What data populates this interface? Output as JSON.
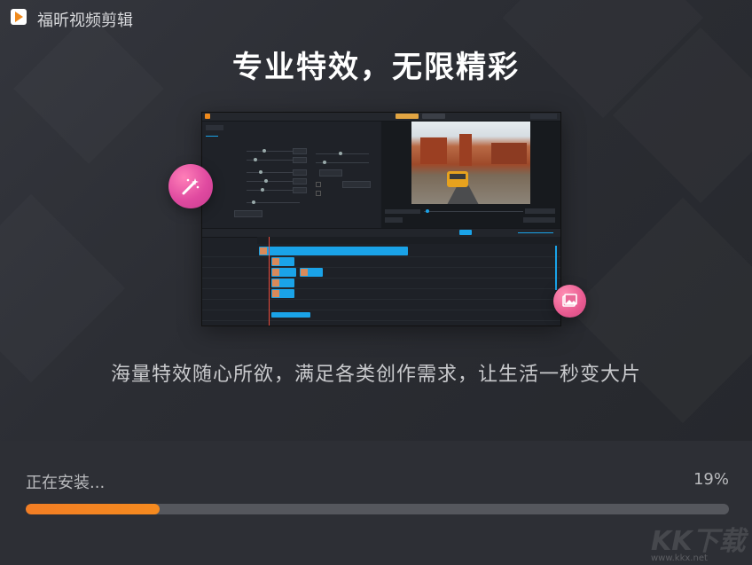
{
  "window": {
    "title": "福昕视频剪辑",
    "logo_icon": "play-logo-icon"
  },
  "hero": {
    "headline": "专业特效，无限精彩",
    "subline": "海量特效随心所欲，满足各类创作需求，让生活一秒变大片"
  },
  "install": {
    "status": "正在安装...",
    "percent_label": "19%",
    "progress": 0.19,
    "accent_color": "#f37e24",
    "track_color": "#55575d"
  },
  "watermark": {
    "text": "KK下载",
    "url": "www.kkx.net"
  }
}
